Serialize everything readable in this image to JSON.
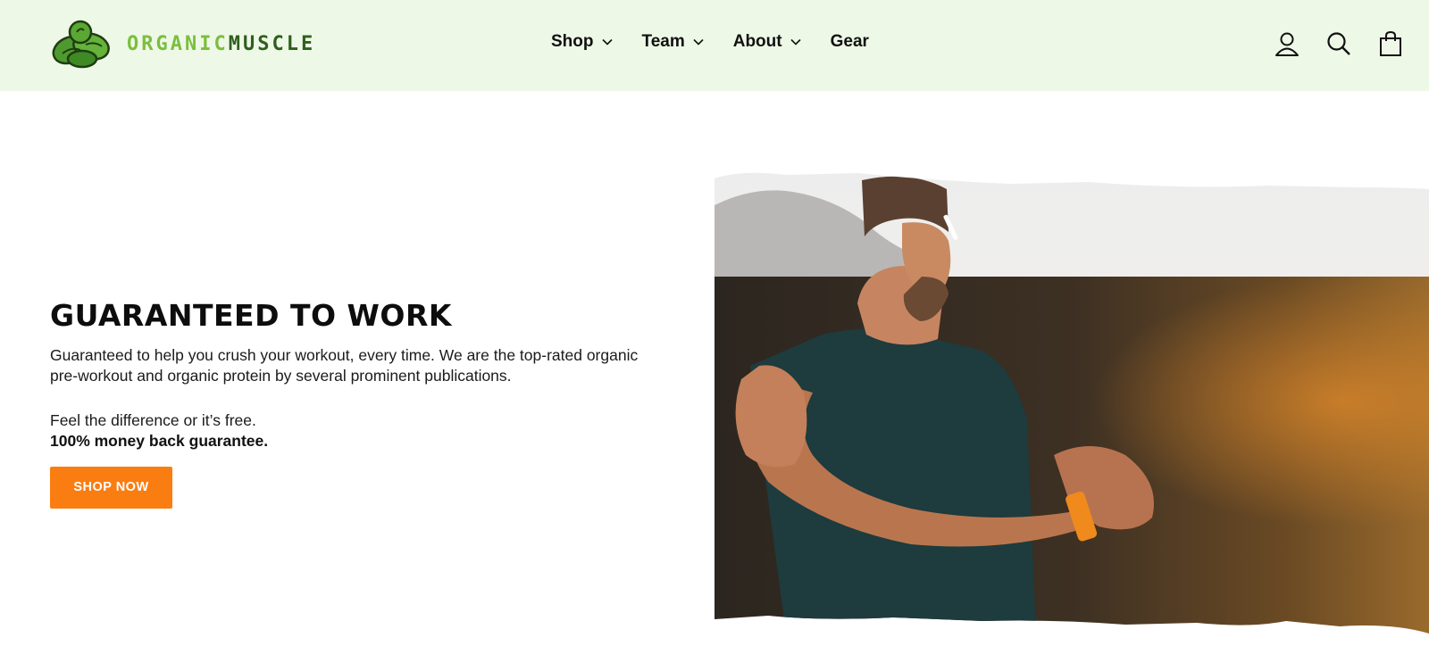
{
  "brand": {
    "logo_icon": "spinach-leaves-logo",
    "name_part1": "ORGANIC",
    "name_part2": "MUSCLE",
    "colors": {
      "light_green": "#7bbf3d",
      "dark_green": "#2f5f1e"
    }
  },
  "header": {
    "background": "#eef8e7",
    "nav": [
      {
        "label": "Shop",
        "has_dropdown": true
      },
      {
        "label": "Team",
        "has_dropdown": true
      },
      {
        "label": "About",
        "has_dropdown": true
      },
      {
        "label": "Gear",
        "has_dropdown": false
      }
    ],
    "icons": [
      "account-icon",
      "search-icon",
      "cart-icon"
    ]
  },
  "hero": {
    "title": "GUARANTEED TO WORK",
    "description": "Guaranteed to help you crush your workout, every time. We are the top-rated organic pre-workout and organic protein by several prominent publications.",
    "subline": "Feel the difference or it’s free.",
    "strong_line": "100% money back guarantee.",
    "cta_label": "SHOP NOW",
    "cta_color": "#fa7d12",
    "image": "athlete-checking-smartwatch-photo"
  }
}
